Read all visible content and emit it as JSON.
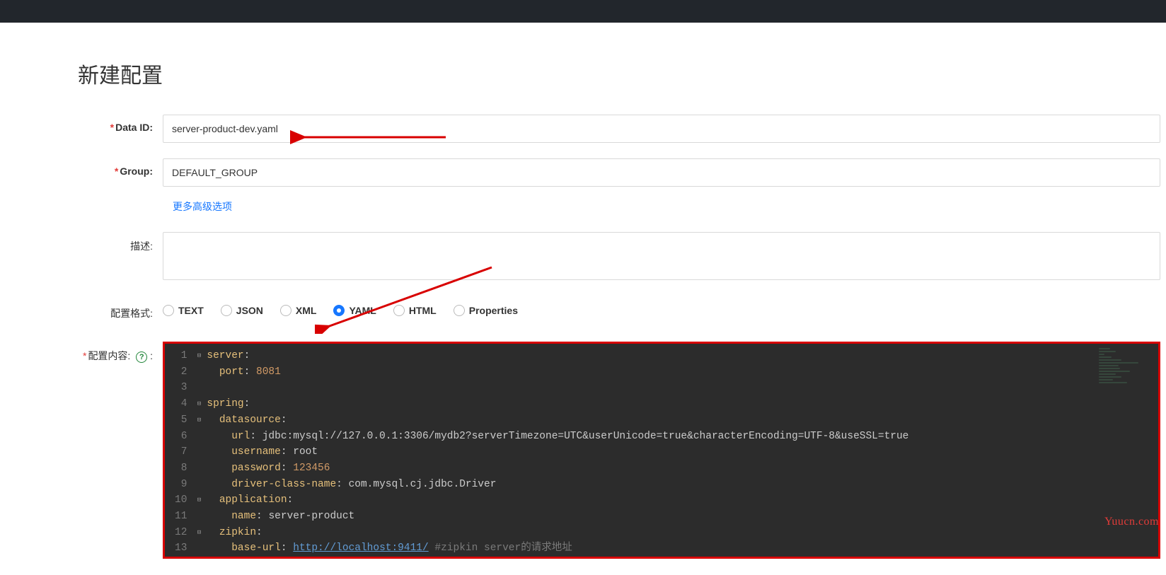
{
  "page": {
    "title": "新建配置"
  },
  "labels": {
    "data_id": "Data ID:",
    "group": "Group:",
    "description": "描述:",
    "format": "配置格式:",
    "content": "配置内容:",
    "advanced": "更多高级选项",
    "required_mark": "*",
    "colon_extra": ":"
  },
  "fields": {
    "data_id": "server-product-dev.yaml",
    "group": "DEFAULT_GROUP",
    "description": ""
  },
  "format_options": [
    {
      "label": "TEXT",
      "value": "text",
      "selected": false
    },
    {
      "label": "JSON",
      "value": "json",
      "selected": false
    },
    {
      "label": "XML",
      "value": "xml",
      "selected": false
    },
    {
      "label": "YAML",
      "value": "yaml",
      "selected": true
    },
    {
      "label": "HTML",
      "value": "html",
      "selected": false
    },
    {
      "label": "Properties",
      "value": "properties",
      "selected": false
    }
  ],
  "editor": {
    "lines": [
      {
        "n": 1,
        "fold": "⊟",
        "tokens": [
          {
            "t": "key",
            "v": "server"
          },
          {
            "t": "colon",
            "v": ":"
          }
        ]
      },
      {
        "n": 2,
        "fold": "",
        "tokens": [
          {
            "t": "indent",
            "v": "  "
          },
          {
            "t": "key",
            "v": "port"
          },
          {
            "t": "colon",
            "v": ": "
          },
          {
            "t": "num",
            "v": "8081"
          }
        ]
      },
      {
        "n": 3,
        "fold": "",
        "tokens": []
      },
      {
        "n": 4,
        "fold": "⊟",
        "tokens": [
          {
            "t": "key",
            "v": "spring"
          },
          {
            "t": "colon",
            "v": ":"
          }
        ]
      },
      {
        "n": 5,
        "fold": "⊟",
        "tokens": [
          {
            "t": "indent",
            "v": "  "
          },
          {
            "t": "key",
            "v": "datasource"
          },
          {
            "t": "colon",
            "v": ":"
          }
        ]
      },
      {
        "n": 6,
        "fold": "",
        "tokens": [
          {
            "t": "indent",
            "v": "    "
          },
          {
            "t": "key",
            "v": "url"
          },
          {
            "t": "colon",
            "v": ": "
          },
          {
            "t": "str",
            "v": "jdbc:mysql://127.0.0.1:3306/mydb2?serverTimezone=UTC&userUnicode=true&characterEncoding=UTF-8&useSSL=true"
          }
        ]
      },
      {
        "n": 7,
        "fold": "",
        "tokens": [
          {
            "t": "indent",
            "v": "    "
          },
          {
            "t": "key",
            "v": "username"
          },
          {
            "t": "colon",
            "v": ": "
          },
          {
            "t": "str",
            "v": "root"
          }
        ]
      },
      {
        "n": 8,
        "fold": "",
        "tokens": [
          {
            "t": "indent",
            "v": "    "
          },
          {
            "t": "key",
            "v": "password"
          },
          {
            "t": "colon",
            "v": ": "
          },
          {
            "t": "num",
            "v": "123456"
          }
        ]
      },
      {
        "n": 9,
        "fold": "",
        "tokens": [
          {
            "t": "indent",
            "v": "    "
          },
          {
            "t": "key",
            "v": "driver-class-name"
          },
          {
            "t": "colon",
            "v": ": "
          },
          {
            "t": "str",
            "v": "com.mysql.cj.jdbc.Driver"
          }
        ]
      },
      {
        "n": 10,
        "fold": "⊟",
        "tokens": [
          {
            "t": "indent",
            "v": "  "
          },
          {
            "t": "key",
            "v": "application"
          },
          {
            "t": "colon",
            "v": ":"
          }
        ]
      },
      {
        "n": 11,
        "fold": "",
        "tokens": [
          {
            "t": "indent",
            "v": "    "
          },
          {
            "t": "key",
            "v": "name"
          },
          {
            "t": "colon",
            "v": ": "
          },
          {
            "t": "str",
            "v": "server-product"
          }
        ]
      },
      {
        "n": 12,
        "fold": "⊟",
        "tokens": [
          {
            "t": "indent",
            "v": "  "
          },
          {
            "t": "key",
            "v": "zipkin"
          },
          {
            "t": "colon",
            "v": ":"
          }
        ]
      },
      {
        "n": 13,
        "fold": "",
        "tokens": [
          {
            "t": "indent",
            "v": "    "
          },
          {
            "t": "key",
            "v": "base-url"
          },
          {
            "t": "colon",
            "v": ": "
          },
          {
            "t": "link",
            "v": "http://localhost:9411/"
          },
          {
            "t": "str",
            "v": " "
          },
          {
            "t": "com",
            "v": "#zipkin server的请求地址"
          }
        ]
      }
    ]
  },
  "watermark": "Yuucn.com"
}
